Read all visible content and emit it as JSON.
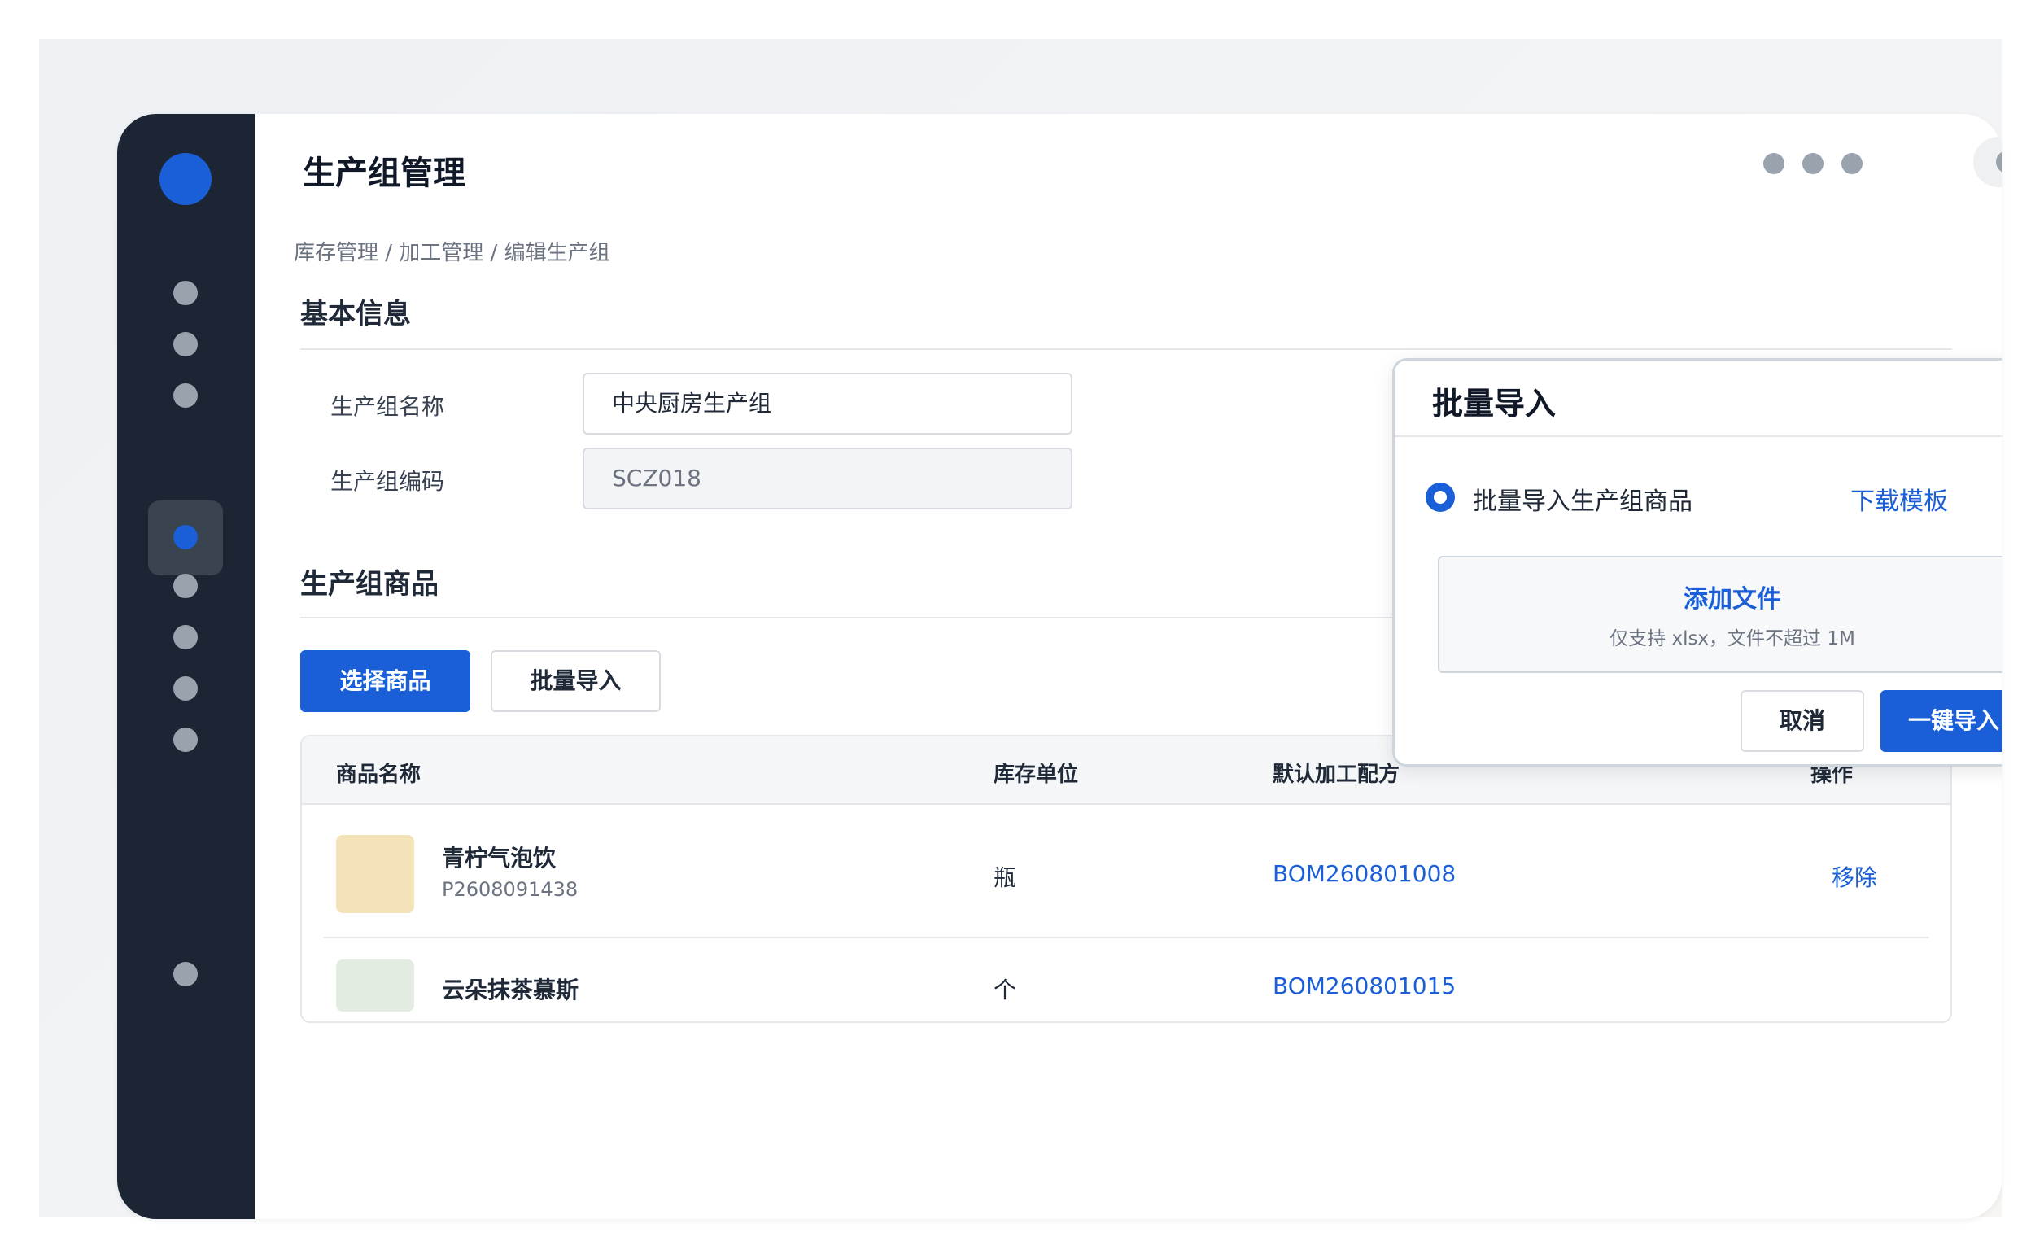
{
  "page": {
    "title": "生产组管理",
    "breadcrumb": "库存管理 / 加工管理 / 编辑生产组"
  },
  "basic_info": {
    "section_title": "基本信息",
    "name_label": "生产组名称",
    "name_value": "中央厨房生产组",
    "code_label": "生产组编码",
    "code_value": "SCZ018"
  },
  "products": {
    "section_title": "生产组商品",
    "select_button": "选择商品",
    "import_button": "批量导入",
    "columns": [
      "商品名称",
      "库存单位",
      "默认加工配方",
      "操作"
    ],
    "rows": [
      {
        "name": "青柠气泡饮",
        "sku": "P2608091438",
        "unit": "瓶",
        "bom": "BOM260801008",
        "action": "移除",
        "thumb_color": "#f4e3b9"
      },
      {
        "name": "云朵抹茶慕斯",
        "sku": "",
        "unit": "个",
        "bom": "BOM260801015",
        "action": "",
        "thumb_color": "#e3ece0"
      }
    ]
  },
  "import_popup": {
    "title": "批量导入",
    "option_label": "批量导入生产组商品",
    "download_link": "下载模板",
    "add_file": "添加文件",
    "file_hint": "仅支持 xlsx，文件不超过 1M",
    "cancel": "取消",
    "confirm": "一键导入"
  },
  "colors": {
    "accent": "#1a5fd8",
    "sidebar": "#1b2533"
  }
}
